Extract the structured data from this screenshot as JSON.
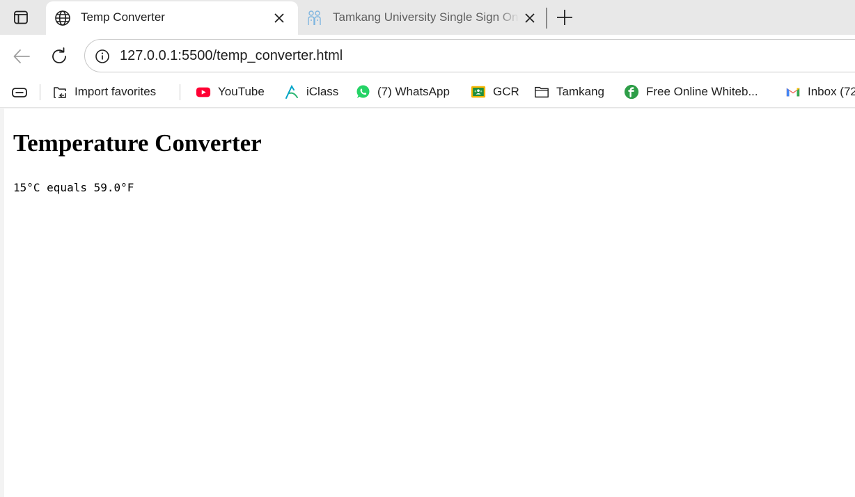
{
  "tabs": [
    {
      "title": "Temp Converter",
      "icon": "globe-icon",
      "active": true
    },
    {
      "title": "Tamkang University Single Sign On",
      "icon": "tamkang-logo-icon",
      "active": false
    }
  ],
  "toolbar": {
    "url": "127.0.0.1:5500/temp_converter.html"
  },
  "bookmarks": [
    {
      "label": "Import favorites",
      "icon": "import-favorites-icon"
    },
    {
      "label": "YouTube",
      "icon": "youtube-icon"
    },
    {
      "label": "iClass",
      "icon": "iclass-icon"
    },
    {
      "label": "(7) WhatsApp",
      "icon": "whatsapp-icon"
    },
    {
      "label": "GCR",
      "icon": "google-classroom-icon"
    },
    {
      "label": "Tamkang",
      "icon": "folder-icon"
    },
    {
      "label": "Free Online Whiteb...",
      "icon": "whiteboard-icon"
    },
    {
      "label": "Inbox (72",
      "icon": "gmail-icon"
    }
  ],
  "page": {
    "heading": "Temperature Converter",
    "result": "15°C equals 59.0°F"
  },
  "colors": {
    "tabstrip_bg": "#e8e8e8",
    "toolbar_bg": "#ffffff",
    "youtube_red": "#ff0033",
    "whatsapp_green": "#25d366",
    "gmail_red": "#ea4335"
  }
}
